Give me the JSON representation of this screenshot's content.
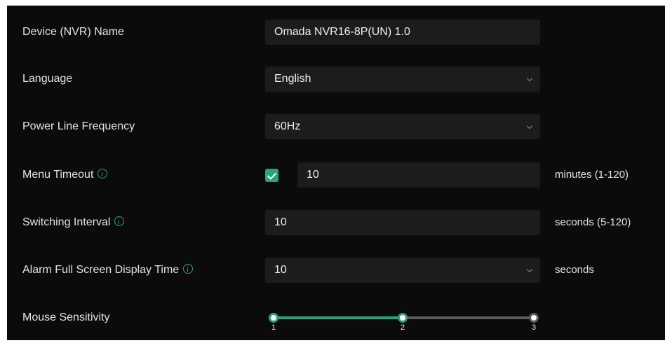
{
  "settings": {
    "device_name": {
      "label": "Device (NVR) Name",
      "value": "Omada NVR16-8P(UN) 1.0"
    },
    "language": {
      "label": "Language",
      "value": "English"
    },
    "power_line_frequency": {
      "label": "Power Line Frequency",
      "value": "60Hz"
    },
    "menu_timeout": {
      "label": "Menu Timeout",
      "enabled": true,
      "value": "10",
      "unit": "minutes (1-120)"
    },
    "switching_interval": {
      "label": "Switching Interval",
      "value": "10",
      "unit": "seconds (5-120)"
    },
    "alarm_display_time": {
      "label": "Alarm Full Screen Display Time",
      "value": "10",
      "unit": "seconds"
    },
    "mouse_sensitivity": {
      "label": "Mouse Sensitivity",
      "value": 2,
      "ticks": [
        "1",
        "2",
        "3"
      ]
    }
  },
  "icons": {
    "info": "info-icon",
    "dropdown": "chevron-down-icon",
    "checkbox": "checkmark-icon"
  },
  "colors": {
    "background": "#0b0b0b",
    "field": "#1c1c1c",
    "accent": "#2aa37d",
    "track_inactive": "#5a5a5a",
    "text": "#e4e4e4"
  }
}
